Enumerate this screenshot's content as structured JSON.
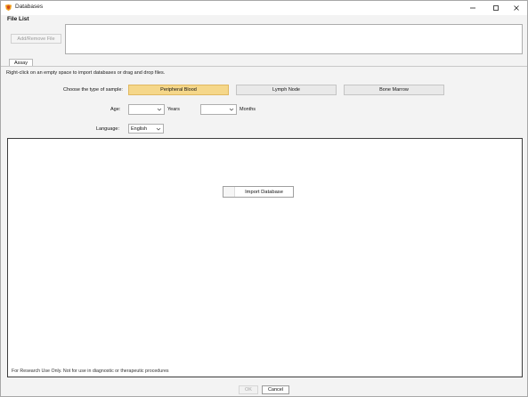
{
  "window": {
    "title": "Databases",
    "app_icon": "app-logo-icon",
    "controls": [
      "minimize-icon",
      "maximize-icon",
      "close-icon"
    ]
  },
  "file_list": {
    "label": "File List",
    "add_remove_label": "Add/Remove File"
  },
  "tabs": [
    {
      "label": "Assay",
      "selected": true
    }
  ],
  "instructions": "Right-click on an empty space to import databases or drag and drop files.",
  "sample": {
    "label": "Choose the type of sample:",
    "options": [
      {
        "label": "Peripheral Blood",
        "selected": true
      },
      {
        "label": "Lymph Node",
        "selected": false
      },
      {
        "label": "Bone Marrow",
        "selected": false
      }
    ],
    "selected_color": "#f5d78a"
  },
  "age": {
    "label": "Age:",
    "years_value": "",
    "years_unit": "Years",
    "months_value": "",
    "months_unit": "Months"
  },
  "language": {
    "label": "Language:",
    "value": "English"
  },
  "main_panel": {
    "import_label": "Import Database",
    "note": "For Research Use Only. Not for use in diagnostic or therapeutic procedures"
  },
  "footer": {
    "ok_label": "OK",
    "cancel_label": "Cancel"
  }
}
